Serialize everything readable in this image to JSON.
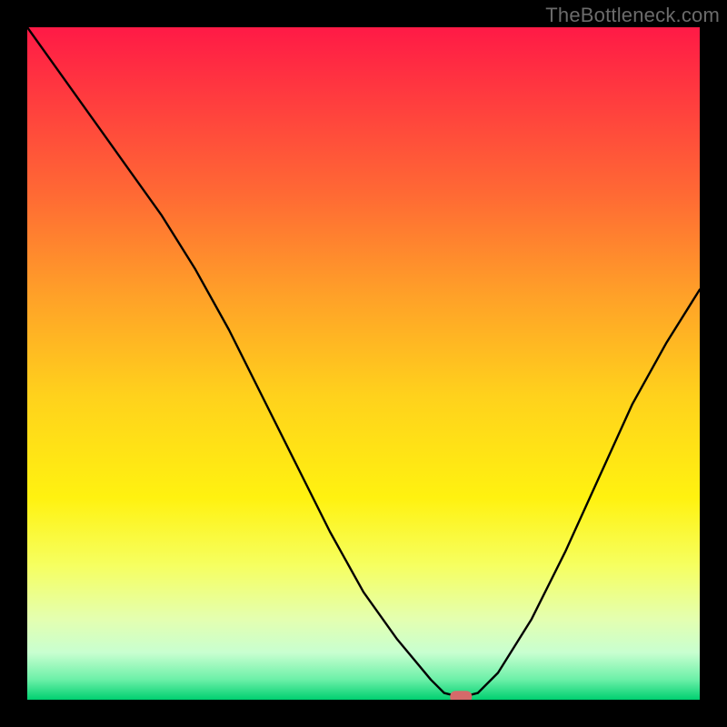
{
  "watermark": "TheBottleneck.com",
  "chart_data": {
    "type": "line",
    "title": "",
    "xlabel": "",
    "ylabel": "",
    "xlim": [
      0,
      100
    ],
    "ylim": [
      0,
      100
    ],
    "grid": false,
    "legend": false,
    "series": [
      {
        "name": "bottleneck-curve",
        "x": [
          0,
          5,
          10,
          15,
          20,
          25,
          30,
          35,
          40,
          45,
          50,
          55,
          60,
          62,
          64,
          65,
          67,
          70,
          75,
          80,
          85,
          90,
          95,
          100
        ],
        "y": [
          100,
          93,
          86,
          79,
          72,
          64,
          55,
          45,
          35,
          25,
          16,
          9,
          3,
          1,
          0.5,
          0.5,
          1,
          4,
          12,
          22,
          33,
          44,
          53,
          61
        ]
      }
    ],
    "marker": {
      "x": 64.5,
      "y": 0.5
    },
    "gradient_stops": [
      {
        "offset": 0.0,
        "color": "#ff1a46"
      },
      {
        "offset": 0.1,
        "color": "#ff3a3f"
      },
      {
        "offset": 0.25,
        "color": "#ff6a34"
      },
      {
        "offset": 0.4,
        "color": "#ffa128"
      },
      {
        "offset": 0.55,
        "color": "#ffd21c"
      },
      {
        "offset": 0.7,
        "color": "#fff210"
      },
      {
        "offset": 0.8,
        "color": "#f6ff60"
      },
      {
        "offset": 0.88,
        "color": "#e4ffb0"
      },
      {
        "offset": 0.93,
        "color": "#c8ffd0"
      },
      {
        "offset": 0.97,
        "color": "#6cf0a8"
      },
      {
        "offset": 1.0,
        "color": "#00d070"
      }
    ],
    "marker_color": "#d46a6a"
  }
}
